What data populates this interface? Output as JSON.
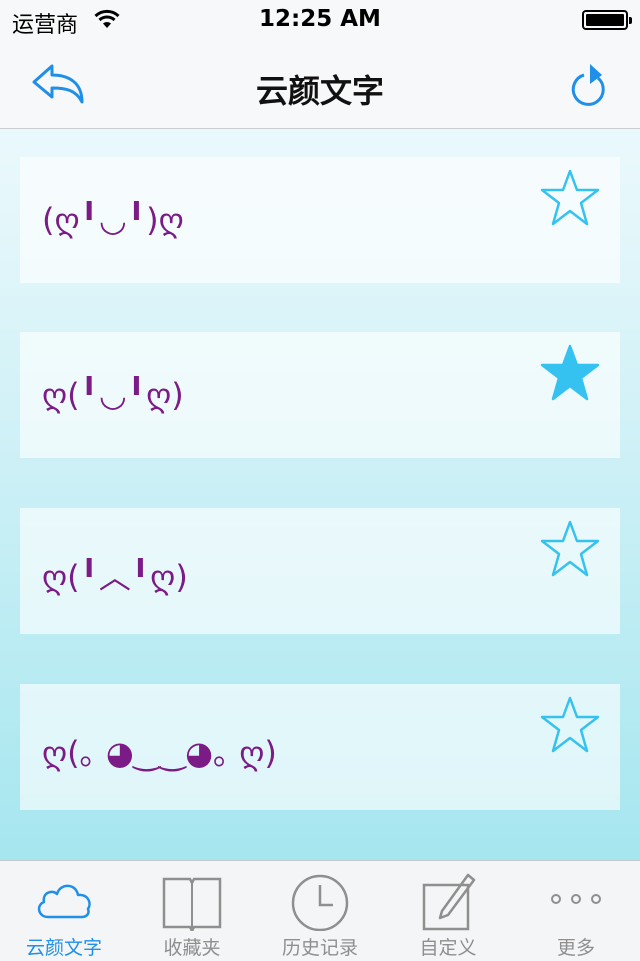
{
  "status_bar": {
    "carrier": "运营商",
    "time": "12:25 AM"
  },
  "nav": {
    "title": "云颜文字"
  },
  "items": [
    {
      "text": "(ღ╹◡╹)ღ",
      "favorited": false
    },
    {
      "text": "ღ(╹◡╹ღ)",
      "favorited": true
    },
    {
      "text": "ღ(╹︿╹ღ)",
      "favorited": false
    },
    {
      "text": "ღ(｡ ◕‿‿◕｡ ღ)",
      "favorited": false
    }
  ],
  "tabs": [
    {
      "label": "云颜文字",
      "icon": "cloud-icon",
      "active": true
    },
    {
      "label": "收藏夹",
      "icon": "book-icon",
      "active": false
    },
    {
      "label": "历史记录",
      "icon": "clock-icon",
      "active": false
    },
    {
      "label": "自定义",
      "icon": "edit-icon",
      "active": false
    },
    {
      "label": "更多",
      "icon": "more-icon",
      "active": false
    }
  ],
  "colors": {
    "accent": "#1f8fe8",
    "star": "#35c2f0",
    "kaomoji": "#7b1c86"
  }
}
